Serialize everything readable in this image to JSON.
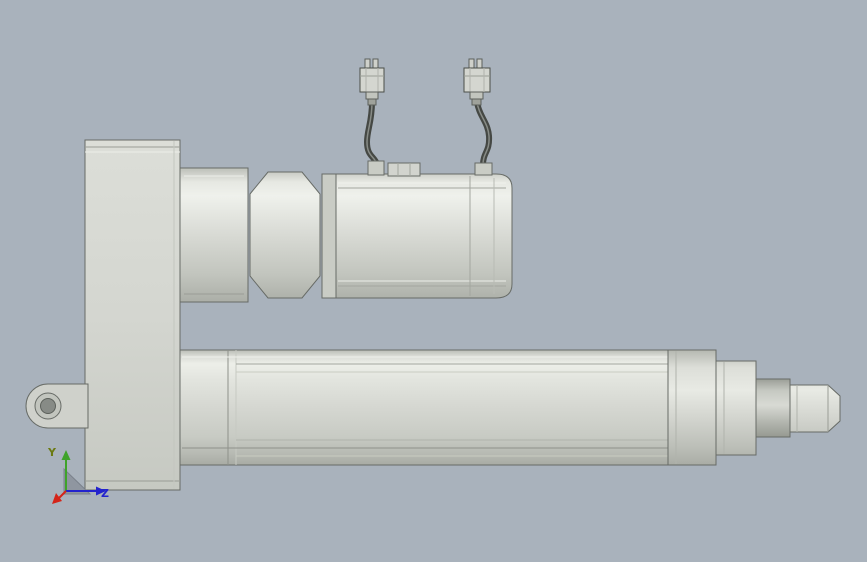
{
  "app": {
    "name": "cad-3d-viewport",
    "background_color": "#a9b2bc"
  },
  "model": {
    "label": "linear actuator with motor and cable connectors",
    "body_color": "#d6d8d2",
    "edge_color": "#676b66",
    "cable_color": "#454844",
    "parts": [
      "clevis-mount",
      "rear-housing-block",
      "motor-adapter",
      "motor-body",
      "cable-connector-1",
      "cable-connector-2",
      "actuator-tube",
      "end-cap",
      "piston-rod",
      "rod-end"
    ]
  },
  "triad": {
    "y_label": "Y",
    "z_label": "Z",
    "x_color": "#d42418",
    "y_color": "#3fa32a",
    "y_label_color": "#6b7a12",
    "z_color": "#2323cd",
    "z_label_color": "#2323cd",
    "plane_color": "#8f96a0"
  }
}
